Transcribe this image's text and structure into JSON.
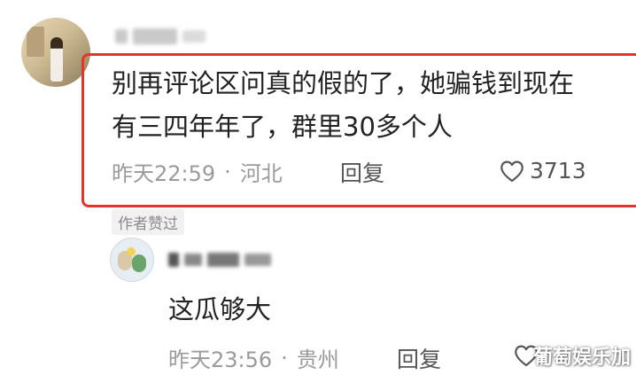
{
  "main_comment": {
    "text": "别再评论区问真的假的了，她骗钱到现在\n有三四年年了，群里30多个人",
    "time": "昨天22:59",
    "separator": "·",
    "location": "河北",
    "reply_label": "回复",
    "likes": "3713",
    "author_liked_badge": "作者赞过"
  },
  "reply_comment": {
    "text": "这瓜够大",
    "time": "昨天23:56",
    "separator": "·",
    "location": "贵州",
    "reply_label": "回复"
  },
  "watermark": "葡萄娱乐加",
  "colors": {
    "highlight_border": "#e5342c",
    "text_primary": "#222222",
    "text_meta": "#9a9a9a"
  }
}
